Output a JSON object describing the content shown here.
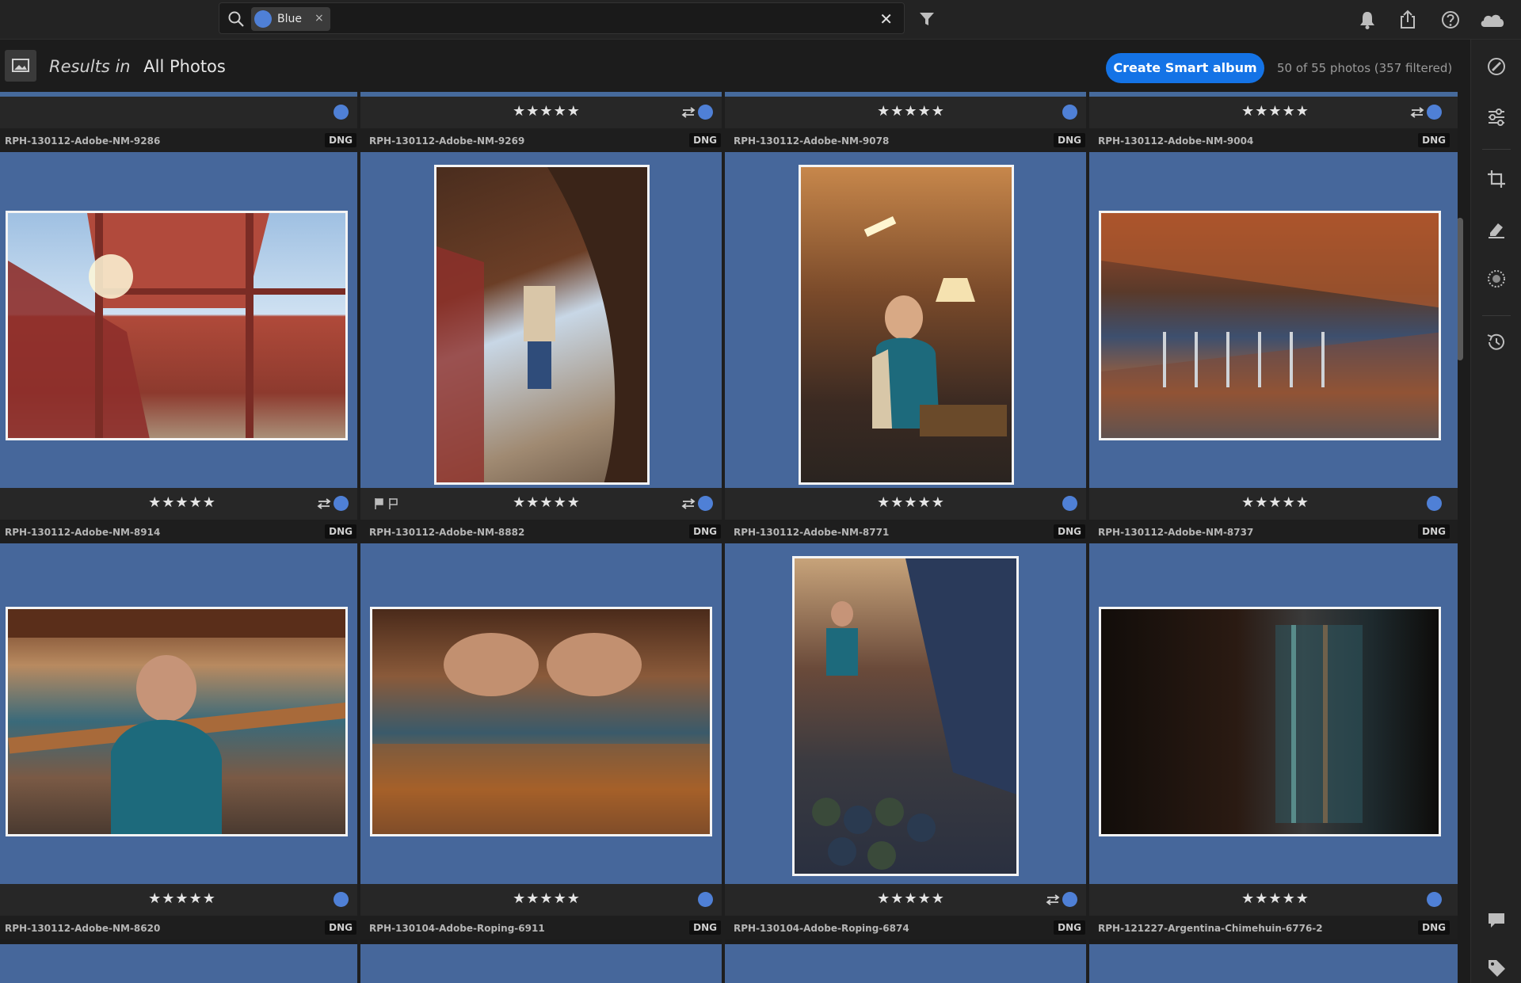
{
  "search": {
    "chip_label": "Blue",
    "chip_remove": "×",
    "clear": "✕"
  },
  "header": {
    "results_prefix": "Results in",
    "album": "All Photos",
    "smart_album_button": "Create Smart album",
    "count": "50 of 55 photos  (357 filtered)"
  },
  "toolbar_icons": [
    "search-icon",
    "filter-icon",
    "bell-icon",
    "share-icon",
    "help-icon",
    "cloud-icon"
  ],
  "side_panel_icons": [
    "edit-icon",
    "sliders-icon",
    "crop-icon",
    "healing-icon",
    "mask-icon",
    "history-icon",
    "comment-icon",
    "tag-icon"
  ],
  "colors": {
    "accent": "#1473e6",
    "blue_label": "#4f80d6",
    "tile_bg": "#46679b"
  },
  "stars": "★★★★★",
  "file_type": "DNG",
  "row1_filenames": [
    "RPH-130112-Adobe-NM-9286",
    "RPH-130112-Adobe-NM-9269",
    "RPH-130112-Adobe-NM-9078",
    "RPH-130112-Adobe-NM-9004"
  ],
  "photos": [
    {
      "filename": "RPH-130112-Adobe-NM-8914",
      "file_type": "DNG",
      "rating": 5,
      "edited": true,
      "flagged": false,
      "label": "Blue"
    },
    {
      "filename": "RPH-130112-Adobe-NM-8882",
      "file_type": "DNG",
      "rating": 5,
      "edited": true,
      "flagged": true,
      "label": "Blue"
    },
    {
      "filename": "RPH-130112-Adobe-NM-8771",
      "file_type": "DNG",
      "rating": 5,
      "edited": false,
      "flagged": false,
      "label": "Blue"
    },
    {
      "filename": "RPH-130112-Adobe-NM-8737",
      "file_type": "DNG",
      "rating": 5,
      "edited": false,
      "flagged": false,
      "label": "Blue"
    },
    {
      "filename": "RPH-130112-Adobe-NM-8620",
      "file_type": "DNG",
      "rating": 5,
      "edited": false,
      "flagged": false,
      "label": "Blue"
    },
    {
      "filename": "RPH-130104-Adobe-Roping-6911",
      "file_type": "DNG",
      "rating": 5,
      "edited": false,
      "flagged": false,
      "label": "Blue"
    },
    {
      "filename": "RPH-130104-Adobe-Roping-6874",
      "file_type": "DNG",
      "rating": 5,
      "edited": true,
      "flagged": false,
      "label": "Blue"
    },
    {
      "filename": "RPH-121227-Argentina-Chimehuin-6776-2",
      "file_type": "DNG",
      "rating": 5,
      "edited": false,
      "flagged": false,
      "label": "Blue"
    }
  ]
}
